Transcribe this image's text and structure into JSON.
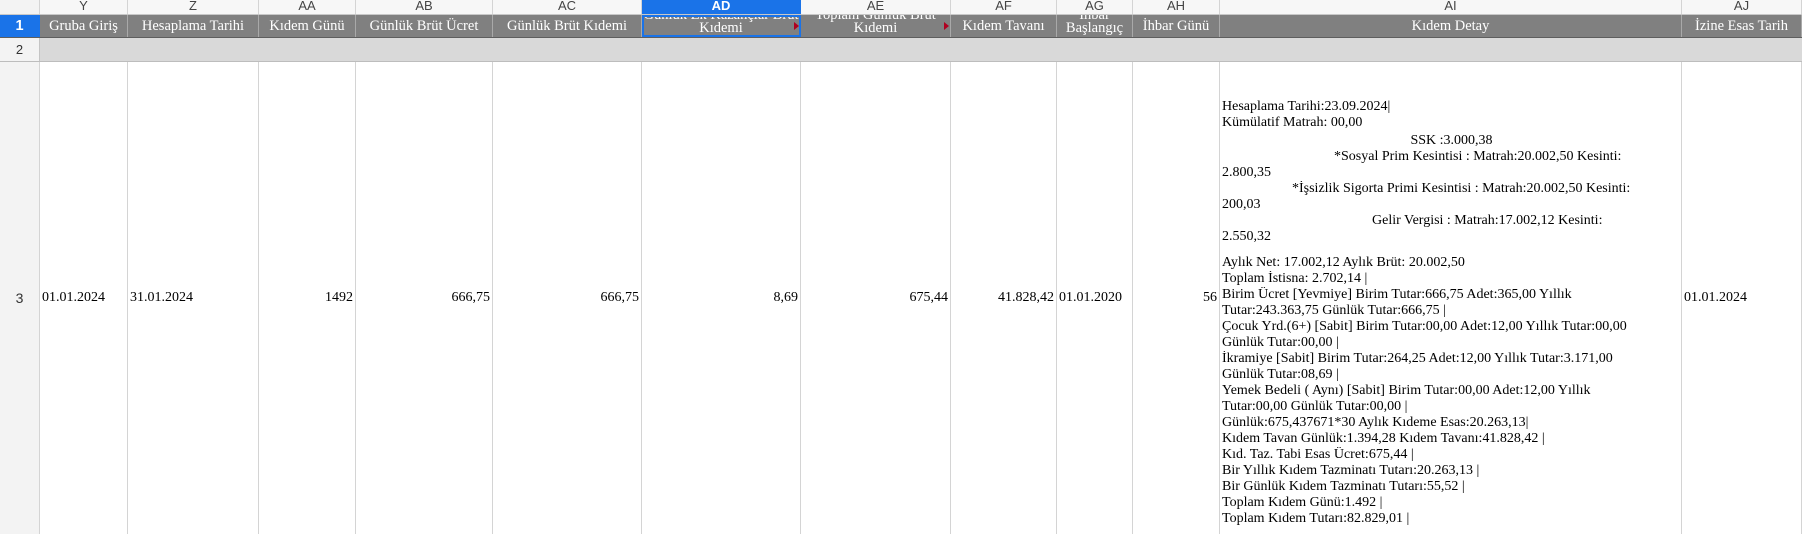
{
  "column_letters": [
    "Y",
    "Z",
    "AA",
    "AB",
    "AC",
    "AD",
    "AE",
    "AF",
    "AG",
    "AH",
    "AI",
    "AJ"
  ],
  "row_numbers": [
    "1",
    "2",
    "3"
  ],
  "headers": {
    "Y": "Gruba Giriş",
    "Z": "Hesaplama Tarihi",
    "AA": "Kıdem Günü",
    "AB": "Günlük Brüt Ücret",
    "AC": "Günlük Brüt Kıdemi",
    "AD": "Günlük Ek Kazançlar Brüt Kıdemi",
    "AE": "Toplam Günlük Brüt Kıdemi",
    "AF": "Kıdem Tavanı",
    "AG": "İhbar Başlangıç",
    "AH": "İhbar Günü",
    "AI": "Kıdem Detay",
    "AJ": "İzine Esas Tarih"
  },
  "row3": {
    "Y": "01.01.2024",
    "Z": "31.01.2024",
    "AA": "1492",
    "AB": "666,75",
    "AC": "666,75",
    "AD": "8,69",
    "AE": "675,44",
    "AF": "41.828,42",
    "AG": "01.01.2020",
    "AH": "56",
    "AJ": "01.01.2024",
    "AI_lines": [
      "Hesaplama Tarihi:23.09.2024|",
      "Kümülatif Matrah: 00,00",
      "SSK :3.000,38",
      "*Sosyal Prim Kesintisi : Matrah:20.002,50 Kesinti:",
      "2.800,35",
      "*İşsizlik Sigorta Primi Kesintisi : Matrah:20.002,50 Kesinti:",
      "200,03",
      "Gelir Vergisi : Matrah:17.002,12 Kesinti:",
      "2.550,32",
      "",
      "Aylık Net: 17.002,12 Aylık Brüt: 20.002,50",
      "Toplam İstisna: 2.702,14 |",
      "Birim Ücret [Yevmiye] Birim Tutar:666,75 Adet:365,00 Yıllık",
      "Tutar:243.363,75  Günlük Tutar:666,75 |",
      "Çocuk Yrd.(6+) [Sabit] Birim Tutar:00,00 Adet:12,00 Yıllık Tutar:00,00",
      "Günlük Tutar:00,00 |",
      "İkramiye [Sabit] Birim Tutar:264,25 Adet:12,00 Yıllık Tutar:3.171,00",
      "Günlük Tutar:08,69 |",
      "Yemek Bedeli  ( Aynı) [Sabit] Birim Tutar:00,00 Adet:12,00 Yıllık",
      "Tutar:00,00  Günlük Tutar:00,00 |",
      "Günlük:675,437671*30  Aylık Kıdeme Esas:20.263,13|",
      "Kıdem Tavan Günlük:1.394,28 Kıdem Tavanı:41.828,42 |",
      "Kıd. Taz. Tabi Esas Ücret:675,44 |",
      "Bir Yıllık Kıdem Tazminatı Tutarı:20.263,13 |",
      "Bir Günlük Kıdem Tazminatı Tutarı:55,52 |",
      "Toplam Kıdem Günü:1.492 |",
      "Toplam Kıdem Tutarı:82.829,01 |"
    ]
  },
  "selected_column": "AD",
  "colors": {
    "header_row_bg": "#808080",
    "selection_accent": "#1a73e8",
    "row2_bg": "#d9d9d9",
    "comment_marker": "#b00020"
  }
}
